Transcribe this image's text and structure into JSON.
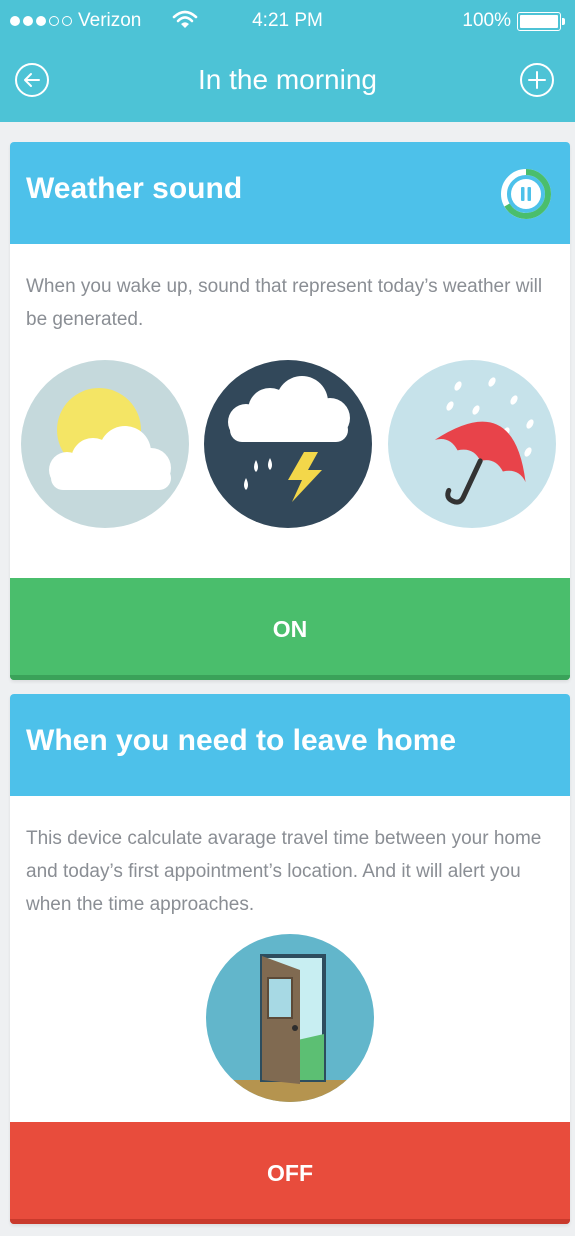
{
  "status_bar": {
    "carrier": "Verizon",
    "time": "4:21 PM",
    "battery": "100%"
  },
  "nav": {
    "title": "In the morning",
    "back_icon": "back-circle-icon",
    "add_icon": "add-circle-icon"
  },
  "cards": [
    {
      "title": "Weather sound",
      "description": "When you wake up, sound that represent today’s weather will be generated.",
      "icons": [
        "sunny-cloud-icon",
        "thunderstorm-icon",
        "rain-umbrella-icon"
      ],
      "button_label": "ON",
      "button_color": "#4abe6c",
      "pause_icon": "pause-ring-icon"
    },
    {
      "title": "When you need to leave home",
      "description": "This device calculate avarage travel time between your home and today’s first appointment’s location. And it will alert you when the time approaches.",
      "icons": [
        "open-door-icon"
      ],
      "button_label": "OFF",
      "button_color": "#e84c3c"
    }
  ],
  "colors": {
    "top_bar": "#4dc3d6",
    "card_header": "#4dc1ea",
    "on": "#4abe6c",
    "off": "#e84c3c"
  }
}
